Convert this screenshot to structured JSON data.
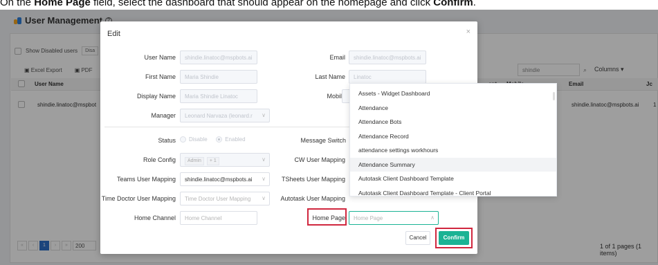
{
  "instruction": {
    "prefix": "On the ",
    "field": "Home Page",
    "middle": " field, select the dashboard that should appear on the homepage and click ",
    "action": "Confirm",
    "suffix": "."
  },
  "page": {
    "title": "User Management",
    "show_disabled": "Show Disabled users",
    "disabled_btn": "Disa",
    "excel_export": "Excel Export",
    "pdf": "PDF",
    "search_value": "shindie",
    "columns": "Columns",
    "headers": {
      "user_name": "User Name",
      "department": "ent",
      "mobile": "Mobile",
      "email": "Email",
      "last": "Jc"
    },
    "row": {
      "user_name": "shindie.linatoc@mspbot",
      "email": "shindie.linatoc@mspbots.ai",
      "last": "1"
    },
    "pager": {
      "current": "1",
      "size": "200",
      "info": "1 of 1 pages (1 items)"
    }
  },
  "modal": {
    "title": "Edit",
    "close": "×",
    "fields": {
      "user_name": {
        "label": "User Name",
        "value": "shindie.linatoc@mspbots.ai"
      },
      "email": {
        "label": "Email",
        "value": "shindie.linatoc@mspbots.ai"
      },
      "first_name": {
        "label": "First Name",
        "value": "Maria Shindie"
      },
      "last_name": {
        "label": "Last Name",
        "value": "Linatoc"
      },
      "display_name": {
        "label": "Display Name",
        "value": "Maria Shindie Linatoc"
      },
      "mobile": {
        "label": "Mobile",
        "value": ""
      },
      "manager": {
        "label": "Manager",
        "value": "Leonard Narvaza (leonard.r"
      },
      "status": {
        "label": "Status",
        "option_disable": "Disable",
        "option_enabled": "Enabled"
      },
      "message_switch": {
        "label": "Message Switch",
        "on": true
      },
      "role_config": {
        "label": "Role Config",
        "tag": "Admin",
        "more": "+ 1"
      },
      "cw_user_mapping": {
        "label": "CW User Mapping"
      },
      "teams_user_mapping": {
        "label": "Teams User Mapping",
        "value": "shindie.linatoc@mspbots.ai"
      },
      "tsheets_user_mapping": {
        "label": "TSheets User Mapping"
      },
      "time_doctor_user_mapping": {
        "label": "Time Doctor User Mapping",
        "placeholder": "Time Doctor User Mapping"
      },
      "autotask_user_mapping": {
        "label": "Autotask User Mapping"
      },
      "home_channel": {
        "label": "Home Channel",
        "placeholder": "Home Channel"
      },
      "home_page": {
        "label": "Home Page",
        "placeholder": "Home Page"
      }
    },
    "cancel_label": "Cancel",
    "confirm_label": "Confirm"
  },
  "home_page_options": [
    "Assets - Widget Dashboard",
    "Attendance",
    "Attendance Bots",
    "Attendance Record",
    "attendance settings workhours",
    "Attendance Summary",
    "Autotask Client Dashboard Template",
    "Autotask Client Dashboard Template - Client Portal"
  ],
  "highlighted_option_index": 5,
  "colors": {
    "accent": "#1bb394",
    "highlight_box": "#d0273e",
    "pager_active": "#2d6ec9"
  }
}
